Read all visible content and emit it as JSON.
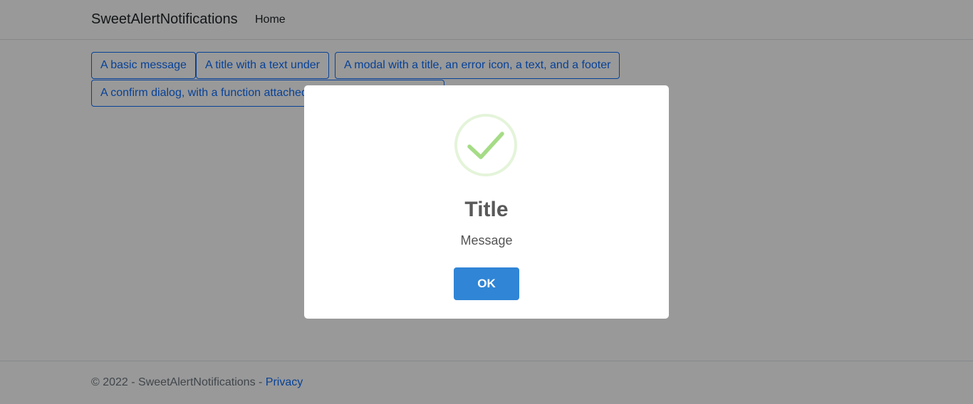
{
  "navbar": {
    "brand": "SweetAlertNotifications",
    "links": [
      "Home"
    ]
  },
  "buttons": [
    "A basic message",
    "A title with a text under",
    "A modal with a title, an error icon, a text, and a footer",
    "A confirm dialog, with a function attached to the \"Confirm\"-button..."
  ],
  "footer": {
    "text": "© 2022 - SweetAlertNotifications - ",
    "link": "Privacy"
  },
  "modal": {
    "icon": "success-check-icon",
    "title": "Title",
    "message": "Message",
    "confirm_label": "OK"
  },
  "colors": {
    "primary": "#0d6efd",
    "confirm": "#3085d6",
    "success": "#a5dc86"
  }
}
